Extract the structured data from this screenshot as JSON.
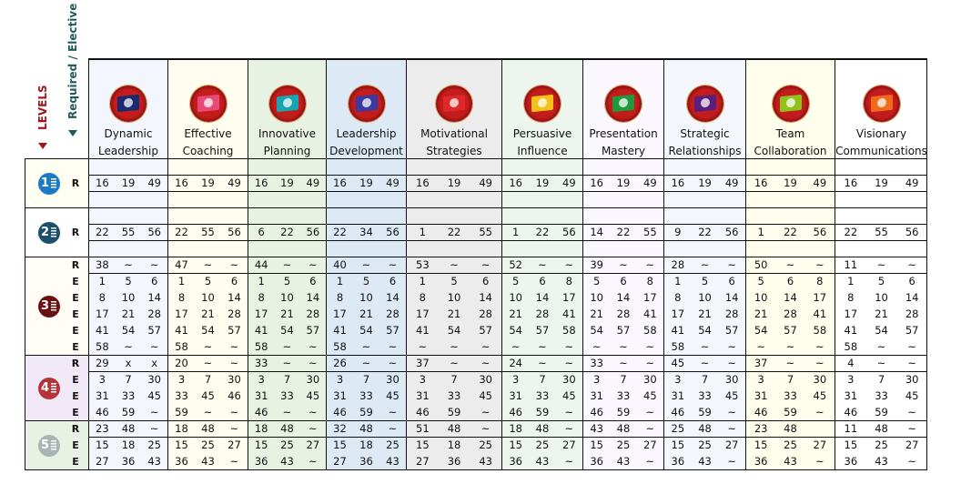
{
  "axis_labels": {
    "levels": "LEVELS",
    "required_elective": "Required / Elective"
  },
  "paths": [
    {
      "name": "Dynamic Leadership",
      "line1": "Dynamic",
      "line2": "Leadership",
      "icon": "flag-d-icon",
      "flag_color": "#1c2a6e",
      "bg": "#f3f7fd"
    },
    {
      "name": "Effective Coaching",
      "line1": "Effective",
      "line2": "Coaching",
      "icon": "flag-coaching-icon",
      "flag_color": "#e84a78",
      "bg": "#fffdf0"
    },
    {
      "name": "Innovative Planning",
      "line1": "Innovative",
      "line2": "Planning",
      "icon": "flag-lightbulb-icon",
      "flag_color": "#1aa3b0",
      "bg": "#e8f2e2"
    },
    {
      "name": "Leadership Development",
      "line1": "Leadership",
      "line2": "Development",
      "icon": "flag-people-icon",
      "flag_color": "#3a3aa0",
      "bg": "#dde9f5"
    },
    {
      "name": "Motivational Strategies",
      "line1": "Motivational",
      "line2": "Strategies",
      "icon": "flag-crowd-icon",
      "flag_color": "#e0282a",
      "bg": "#ececec"
    },
    {
      "name": "Persuasive Influence",
      "line1": "Persuasive",
      "line2": "Influence",
      "icon": "flag-handshake-icon",
      "flag_color": "#f2c21a",
      "bg": "#eef5ee"
    },
    {
      "name": "Presentation Mastery",
      "line1": "Presentation",
      "line2": "Mastery",
      "icon": "flag-microphone-icon",
      "flag_color": "#1f9a3a",
      "bg": "#faf8fe"
    },
    {
      "name": "Strategic Relationships",
      "line1": "Strategic",
      "line2": "Relationships",
      "icon": "flag-handshake-icon",
      "flag_color": "#5a1f7a",
      "bg": "#f3f7fc"
    },
    {
      "name": "Team Collaboration",
      "line1": "Team",
      "line2": "Collaboration",
      "icon": "flag-team-icon",
      "flag_color": "#8fc21a",
      "bg": "#fffdec"
    },
    {
      "name": "Visionary Communications",
      "line1": "Visionary",
      "line2": "Communications",
      "icon": "flag-telescope-icon",
      "flag_color": "#f06a1a",
      "bg": "#ffffff"
    }
  ],
  "levels": [
    {
      "number": "1",
      "color": "#1a7bc4",
      "bg": "#fffef3",
      "rows": [
        {
          "type": "",
          "cells": null
        },
        {
          "type": "R",
          "cells": [
            [
              "16",
              "19",
              "49"
            ],
            [
              "16",
              "19",
              "49"
            ],
            [
              "16",
              "19",
              "49"
            ],
            [
              "16",
              "19",
              "49"
            ],
            [
              "16",
              "19",
              "49"
            ],
            [
              "16",
              "19",
              "49"
            ],
            [
              "16",
              "19",
              "49"
            ],
            [
              "16",
              "19",
              "49"
            ],
            [
              "16",
              "19",
              "49"
            ],
            [
              "16",
              "19",
              "49"
            ]
          ]
        },
        {
          "type": "",
          "cells": null
        }
      ]
    },
    {
      "number": "2",
      "color": "#1a4f6e",
      "bg": "#ffffff",
      "rows": [
        {
          "type": "",
          "cells": null
        },
        {
          "type": "R",
          "cells": [
            [
              "22",
              "55",
              "56"
            ],
            [
              "22",
              "55",
              "56"
            ],
            [
              "6",
              "22",
              "56"
            ],
            [
              "22",
              "34",
              "56"
            ],
            [
              "1",
              "22",
              "55"
            ],
            [
              "1",
              "22",
              "56"
            ],
            [
              "14",
              "22",
              "55"
            ],
            [
              "9",
              "22",
              "56"
            ],
            [
              "1",
              "22",
              "56"
            ],
            [
              "22",
              "55",
              "56"
            ]
          ]
        },
        {
          "type": "",
          "cells": null
        }
      ]
    },
    {
      "number": "3",
      "color": "#6b0f0f",
      "bg": "#fffdf6",
      "rows": [
        {
          "type": "R",
          "cells": [
            [
              "38",
              "~",
              "~"
            ],
            [
              "47",
              "~",
              "~"
            ],
            [
              "44",
              "~",
              "~"
            ],
            [
              "40",
              "~",
              "~"
            ],
            [
              "53",
              "~",
              "~"
            ],
            [
              "52",
              "~",
              "~"
            ],
            [
              "39",
              "~",
              "~"
            ],
            [
              "28",
              "~",
              "~"
            ],
            [
              "50",
              "~",
              "~"
            ],
            [
              "11",
              "~",
              "~"
            ]
          ]
        },
        {
          "type": "E",
          "cells": [
            [
              "1",
              "5",
              "6"
            ],
            [
              "1",
              "5",
              "6"
            ],
            [
              "1",
              "5",
              "6"
            ],
            [
              "1",
              "5",
              "6"
            ],
            [
              "1",
              "5",
              "6"
            ],
            [
              "5",
              "6",
              "8"
            ],
            [
              "5",
              "6",
              "8"
            ],
            [
              "1",
              "5",
              "6"
            ],
            [
              "5",
              "6",
              "8"
            ],
            [
              "1",
              "5",
              "6"
            ]
          ]
        },
        {
          "type": "E",
          "cells": [
            [
              "8",
              "10",
              "14"
            ],
            [
              "8",
              "10",
              "14"
            ],
            [
              "8",
              "10",
              "14"
            ],
            [
              "8",
              "10",
              "14"
            ],
            [
              "8",
              "10",
              "14"
            ],
            [
              "10",
              "14",
              "17"
            ],
            [
              "10",
              "14",
              "17"
            ],
            [
              "8",
              "10",
              "14"
            ],
            [
              "10",
              "14",
              "17"
            ],
            [
              "8",
              "10",
              "14"
            ]
          ]
        },
        {
          "type": "E",
          "cells": [
            [
              "17",
              "21",
              "28"
            ],
            [
              "17",
              "21",
              "28"
            ],
            [
              "17",
              "21",
              "28"
            ],
            [
              "17",
              "21",
              "28"
            ],
            [
              "17",
              "21",
              "28"
            ],
            [
              "21",
              "28",
              "41"
            ],
            [
              "21",
              "28",
              "41"
            ],
            [
              "17",
              "21",
              "28"
            ],
            [
              "21",
              "28",
              "41"
            ],
            [
              "17",
              "21",
              "28"
            ]
          ]
        },
        {
          "type": "E",
          "cells": [
            [
              "41",
              "54",
              "57"
            ],
            [
              "41",
              "54",
              "57"
            ],
            [
              "41",
              "54",
              "57"
            ],
            [
              "41",
              "54",
              "57"
            ],
            [
              "41",
              "54",
              "57"
            ],
            [
              "54",
              "57",
              "58"
            ],
            [
              "54",
              "57",
              "58"
            ],
            [
              "41",
              "54",
              "57"
            ],
            [
              "54",
              "57",
              "58"
            ],
            [
              "41",
              "54",
              "57"
            ]
          ]
        },
        {
          "type": "E",
          "cells": [
            [
              "58",
              "~",
              "~"
            ],
            [
              "58",
              "~",
              "~"
            ],
            [
              "58",
              "~",
              "~"
            ],
            [
              "58",
              "~",
              "~"
            ],
            [
              "~",
              "~",
              "~"
            ],
            [
              "~",
              "~",
              "~"
            ],
            [
              "~",
              "~",
              "~"
            ],
            [
              "58",
              "~",
              "~"
            ],
            [
              "~",
              "~",
              "~"
            ],
            [
              "58",
              "~",
              "~"
            ]
          ]
        }
      ]
    },
    {
      "number": "4",
      "color": "#b3353a",
      "bg": "#f1e9f7",
      "rows": [
        {
          "type": "R",
          "cells": [
            [
              "29",
              "x",
              "x"
            ],
            [
              "20",
              "~",
              "~"
            ],
            [
              "33",
              "~",
              "~"
            ],
            [
              "26",
              "~",
              "~"
            ],
            [
              "37",
              "~",
              "~"
            ],
            [
              "24",
              "~",
              "~"
            ],
            [
              "33",
              "~",
              "~"
            ],
            [
              "45",
              "~",
              "~"
            ],
            [
              "37",
              "~",
              "~"
            ],
            [
              "4",
              "~",
              "~"
            ]
          ]
        },
        {
          "type": "E",
          "cells": [
            [
              "3",
              "7",
              "30"
            ],
            [
              "3",
              "7",
              "30"
            ],
            [
              "3",
              "7",
              "30"
            ],
            [
              "3",
              "7",
              "30"
            ],
            [
              "3",
              "7",
              "30"
            ],
            [
              "3",
              "7",
              "30"
            ],
            [
              "3",
              "7",
              "30"
            ],
            [
              "3",
              "7",
              "30"
            ],
            [
              "3",
              "7",
              "30"
            ],
            [
              "3",
              "7",
              "30"
            ]
          ]
        },
        {
          "type": "E",
          "cells": [
            [
              "31",
              "33",
              "45"
            ],
            [
              "33",
              "45",
              "46"
            ],
            [
              "31",
              "33",
              "45"
            ],
            [
              "31",
              "33",
              "45"
            ],
            [
              "31",
              "33",
              "45"
            ],
            [
              "31",
              "33",
              "45"
            ],
            [
              "31",
              "33",
              "45"
            ],
            [
              "31",
              "33",
              "45"
            ],
            [
              "31",
              "33",
              "45"
            ],
            [
              "31",
              "33",
              "45"
            ]
          ]
        },
        {
          "type": "E",
          "cells": [
            [
              "46",
              "59",
              "~"
            ],
            [
              "59",
              "~",
              "~"
            ],
            [
              "46",
              "~",
              "~"
            ],
            [
              "46",
              "59",
              "~"
            ],
            [
              "46",
              "59",
              "~"
            ],
            [
              "46",
              "59",
              "~"
            ],
            [
              "46",
              "59",
              "~"
            ],
            [
              "46",
              "59",
              "~"
            ],
            [
              "46",
              "59",
              "~"
            ],
            [
              "46",
              "59",
              "~"
            ]
          ]
        }
      ]
    },
    {
      "number": "5",
      "color": "#a9b4b4",
      "bg": "#e8f2e4",
      "rows": [
        {
          "type": "R",
          "cells": [
            [
              "23",
              "48",
              "~"
            ],
            [
              "18",
              "48",
              "~"
            ],
            [
              "18",
              "48",
              "~"
            ],
            [
              "32",
              "48",
              "~"
            ],
            [
              "51",
              "48",
              "~"
            ],
            [
              "18",
              "48",
              "~"
            ],
            [
              "43",
              "48",
              "~"
            ],
            [
              "25",
              "48",
              "~"
            ],
            [
              "23",
              "48",
              ""
            ],
            [
              "11",
              "48",
              "~"
            ]
          ]
        },
        {
          "type": "E",
          "cells": [
            [
              "15",
              "18",
              "25"
            ],
            [
              "15",
              "25",
              "27"
            ],
            [
              "15",
              "25",
              "27"
            ],
            [
              "15",
              "18",
              "25"
            ],
            [
              "15",
              "18",
              "25"
            ],
            [
              "15",
              "25",
              "27"
            ],
            [
              "15",
              "25",
              "27"
            ],
            [
              "15",
              "25",
              "27"
            ],
            [
              "15",
              "25",
              "27"
            ],
            [
              "15",
              "25",
              "27"
            ]
          ]
        },
        {
          "type": "E",
          "cells": [
            [
              "27",
              "36",
              "43"
            ],
            [
              "36",
              "43",
              "~"
            ],
            [
              "36",
              "43",
              "~"
            ],
            [
              "27",
              "36",
              "43"
            ],
            [
              "27",
              "36",
              "43"
            ],
            [
              "36",
              "43",
              "~"
            ],
            [
              "36",
              "43",
              "~"
            ],
            [
              "36",
              "43",
              "~"
            ],
            [
              "36",
              "43",
              "~"
            ],
            [
              "36",
              "43",
              "~"
            ]
          ]
        }
      ]
    }
  ]
}
